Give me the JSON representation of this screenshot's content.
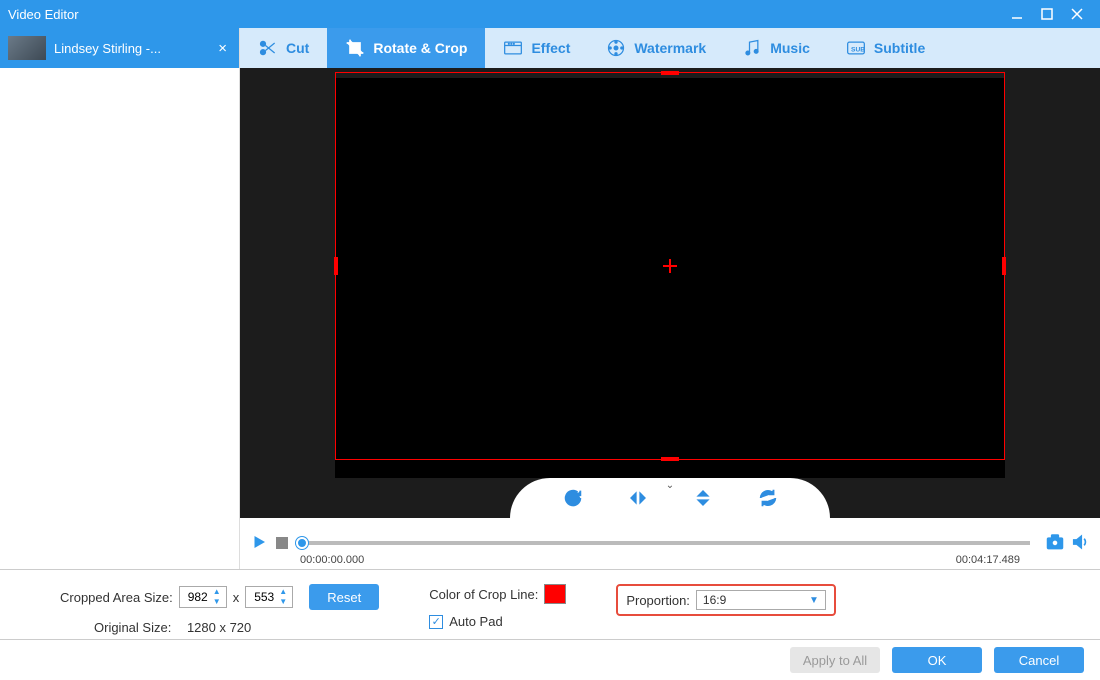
{
  "window": {
    "title": "Video Editor"
  },
  "sidebar": {
    "items": [
      {
        "name": "Lindsey Stirling -..."
      }
    ]
  },
  "tabs": {
    "cut": "Cut",
    "rotate_crop": "Rotate & Crop",
    "effect": "Effect",
    "watermark": "Watermark",
    "music": "Music",
    "subtitle": "Subtitle",
    "active": "rotate_crop"
  },
  "playback": {
    "current_time": "00:00:00.000",
    "total_time": "00:04:17.489"
  },
  "crop": {
    "area_label": "Cropped Area Size:",
    "width": "982",
    "height": "553",
    "x_sep": "x",
    "reset": "Reset",
    "original_label": "Original Size:",
    "original_value": "1280 x 720",
    "color_label": "Color of Crop Line:",
    "color_value": "#ff0000",
    "auto_pad_label": "Auto Pad",
    "auto_pad_checked": true,
    "proportion_label": "Proportion:",
    "proportion_value": "16:9"
  },
  "footer": {
    "apply_all": "Apply to All",
    "ok": "OK",
    "cancel": "Cancel"
  }
}
